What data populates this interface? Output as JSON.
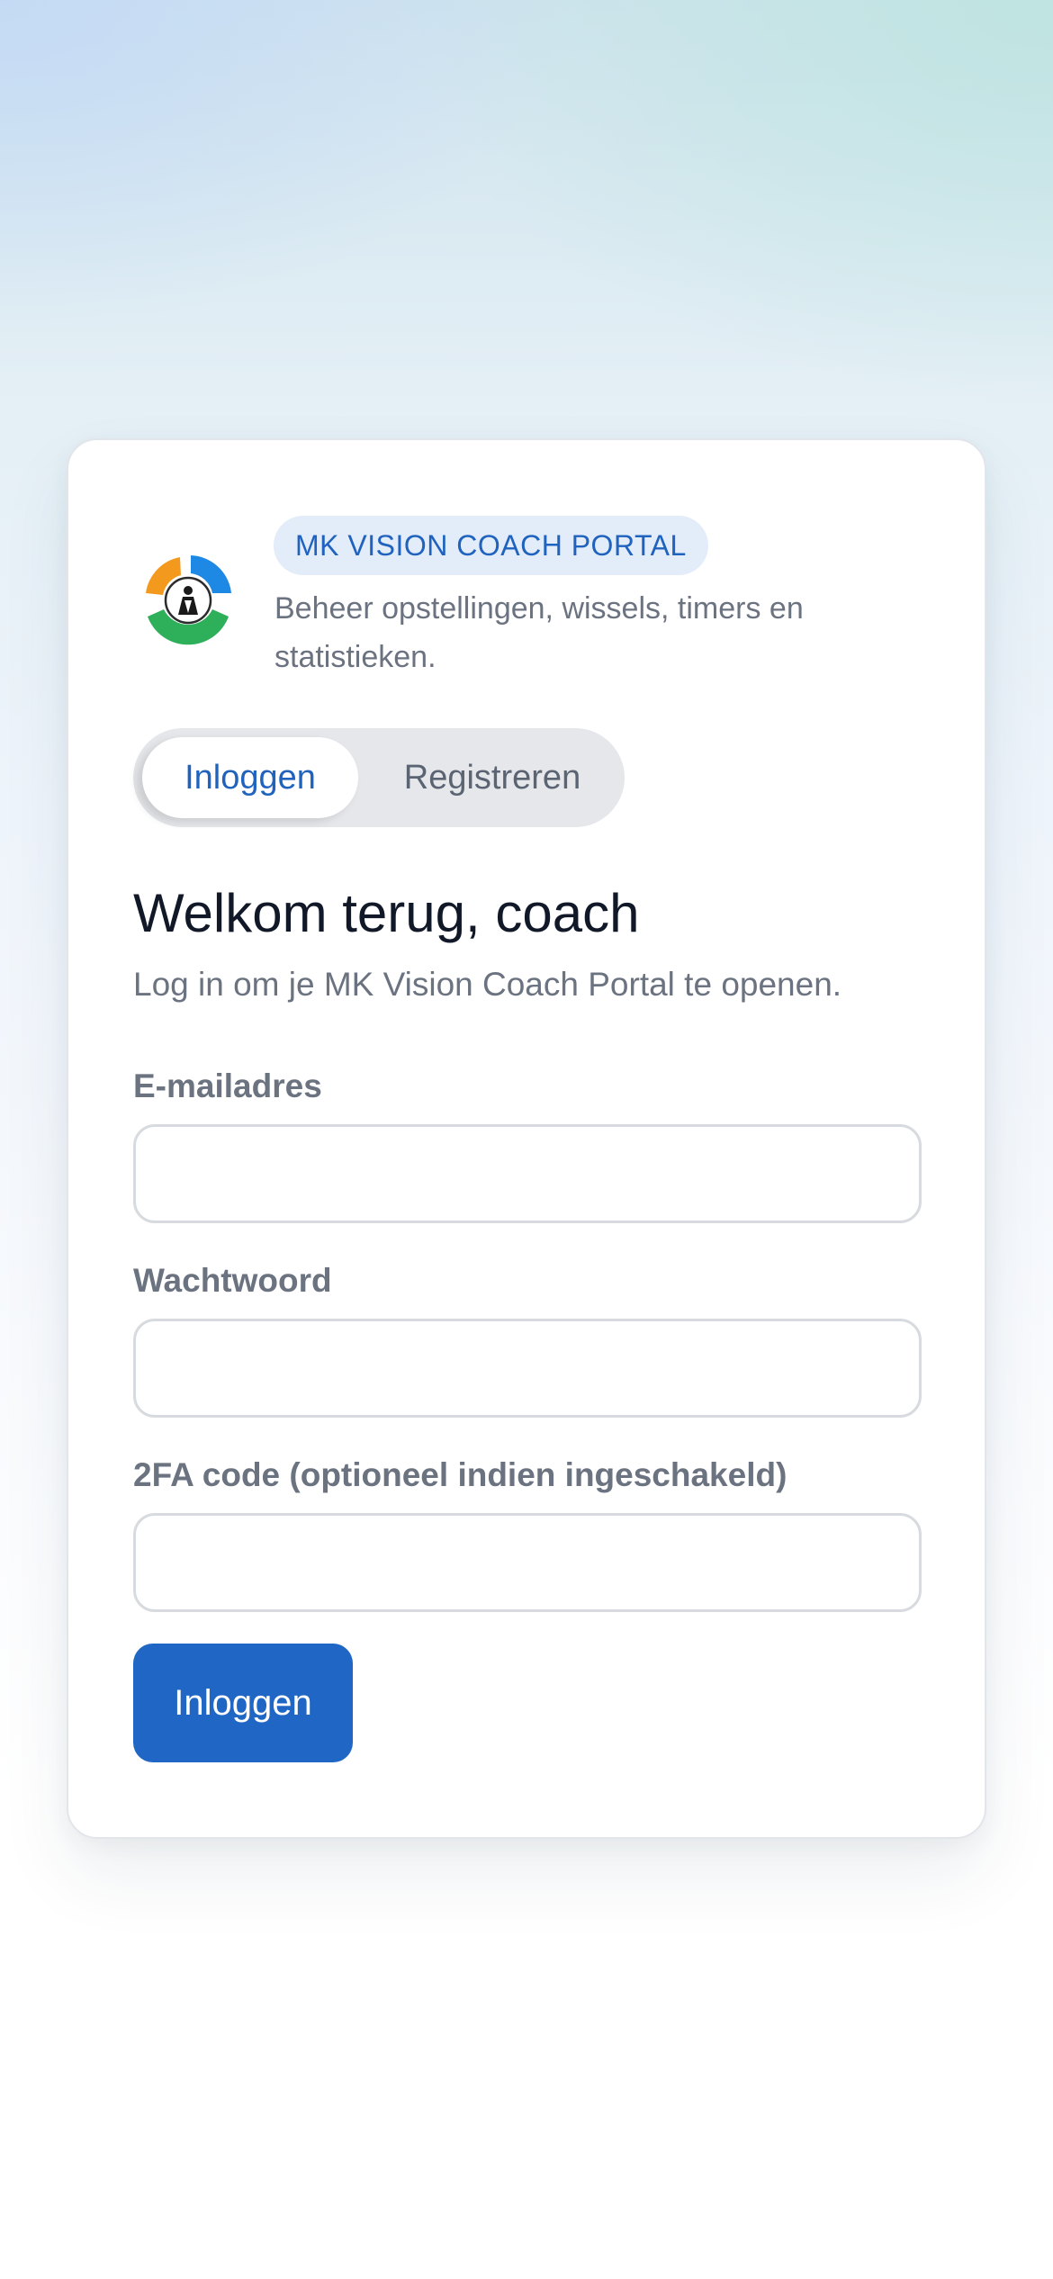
{
  "header": {
    "badge": "MK VISION COACH PORTAL",
    "subtitle": "Beheer opstellingen, wissels, timers en statistieken."
  },
  "tabs": [
    {
      "label": "Inloggen",
      "active": true
    },
    {
      "label": "Registreren",
      "active": false
    }
  ],
  "form": {
    "title": "Welkom terug, coach",
    "lead": "Log in om je MK Vision Coach Portal te openen.",
    "email_label": "E-mailadres",
    "email_value": "",
    "password_label": "Wachtwoord",
    "password_value": "",
    "twofa_label": "2FA code (optioneel indien ingeschakeld)",
    "twofa_value": "",
    "submit_label": "Inloggen"
  },
  "colors": {
    "accent": "#1f66c5",
    "logo_orange": "#f39a1e",
    "logo_blue": "#1e88e5",
    "logo_green": "#2eaf5a"
  },
  "icons": {
    "logo": "mk-vision-logo"
  }
}
